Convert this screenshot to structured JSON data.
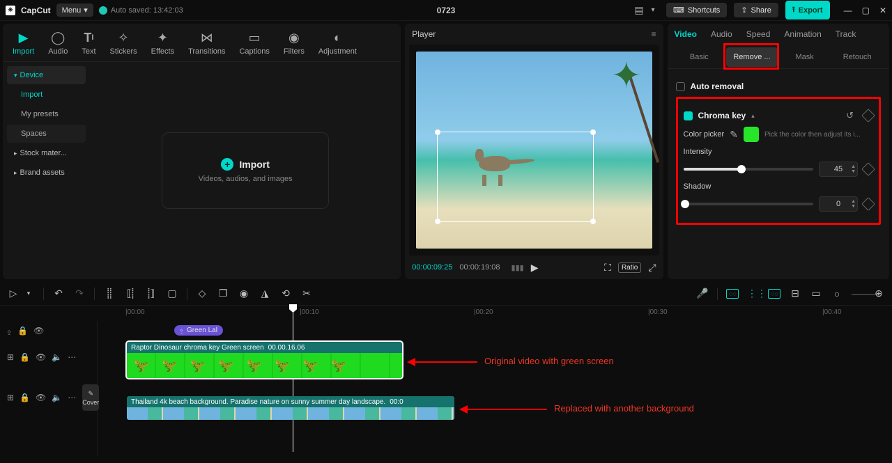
{
  "titlebar": {
    "app": "CapCut",
    "menu": "Menu",
    "autosave": "Auto saved: 13:42:03",
    "project": "0723",
    "shortcuts": "Shortcuts",
    "share": "Share",
    "export": "Export"
  },
  "media": {
    "tabs": {
      "import": "Import",
      "audio": "Audio",
      "text": "Text",
      "stickers": "Stickers",
      "effects": "Effects",
      "transitions": "Transitions",
      "captions": "Captions",
      "filters": "Filters",
      "adjust": "Adjustment"
    },
    "side": {
      "device": "Device",
      "import": "Import",
      "presets": "My presets",
      "spaces": "Spaces",
      "stock": "Stock mater...",
      "brand": "Brand assets"
    },
    "drop_title": "Import",
    "drop_sub": "Videos, audios, and images"
  },
  "player": {
    "title": "Player",
    "tc_current": "00:00:09:25",
    "tc_total": "00:00:19:08",
    "ratio": "Ratio"
  },
  "inspector": {
    "tabs": {
      "video": "Video",
      "audio": "Audio",
      "speed": "Speed",
      "animation": "Animation",
      "track": "Track"
    },
    "sub": {
      "basic": "Basic",
      "remove": "Remove ...",
      "mask": "Mask",
      "retouch": "Retouch"
    },
    "auto_removal": "Auto removal",
    "chroma": "Chroma key",
    "color_picker": "Color picker",
    "hint": "Pick the color then adjust its i...",
    "intensity": "Intensity",
    "intensity_val": "45",
    "shadow": "Shadow",
    "shadow_val": "0"
  },
  "timeline": {
    "ticks": {
      "t0": "|00:00",
      "t10": "|00:10",
      "t20": "|00:20",
      "t30": "|00:30",
      "t40": "|00:40"
    },
    "tag": "Green Lal",
    "clip1_title": "Raptor Dinosaur chroma key Green screen",
    "clip1_dur": "00.00.16.06",
    "clip2_title": "Thailand 4k beach background. Paradise nature on sunny summer day landscape.",
    "clip2_dur": "00:0",
    "cover": "Cover",
    "anno1": "Original video with green screen",
    "anno2": "Replaced with another background"
  }
}
